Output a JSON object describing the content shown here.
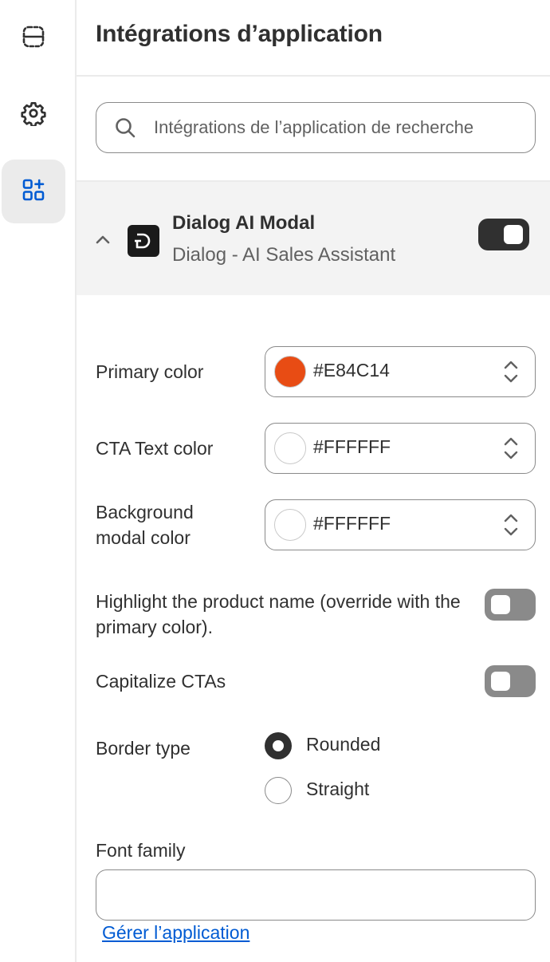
{
  "page": {
    "title": "Intégrations d’application"
  },
  "sidebar": {
    "items": [
      {
        "icon": "app-layout-icon",
        "active": false
      },
      {
        "icon": "gear-icon",
        "active": false
      },
      {
        "icon": "apps-add-icon",
        "active": true
      }
    ]
  },
  "search": {
    "placeholder": "Intégrations de l’application de recherche",
    "value": ""
  },
  "app": {
    "name": "Dialog AI Modal",
    "subtitle": "Dialog - AI Sales Assistant",
    "enabled": true,
    "logo_letter": "D"
  },
  "settings": {
    "primary_color": {
      "label": "Primary color",
      "value": "#E84C14",
      "swatch": "#E84C14"
    },
    "cta_text_color": {
      "label": "CTA Text color",
      "value": "#FFFFFF",
      "swatch": "#FFFFFF"
    },
    "background_modal_color": {
      "label": "Background modal color",
      "value": "#FFFFFF",
      "swatch": "#FFFFFF"
    },
    "highlight_product_name": {
      "label": "Highlight the product name (override with the primary color).",
      "enabled": false
    },
    "capitalize_ctas": {
      "label": "Capitalize CTAs",
      "enabled": false
    },
    "border_type": {
      "label": "Border type",
      "options": [
        "Rounded",
        "Straight"
      ],
      "selected": "Rounded"
    },
    "font_family": {
      "label": "Font family",
      "value": ""
    }
  },
  "footer": {
    "manage_link": "Gérer l’application"
  },
  "colors": {
    "toggle_on": "#303030",
    "toggle_off": "#8a8a8a",
    "link": "#005bd3",
    "header_bg": "#f3f3f3"
  }
}
